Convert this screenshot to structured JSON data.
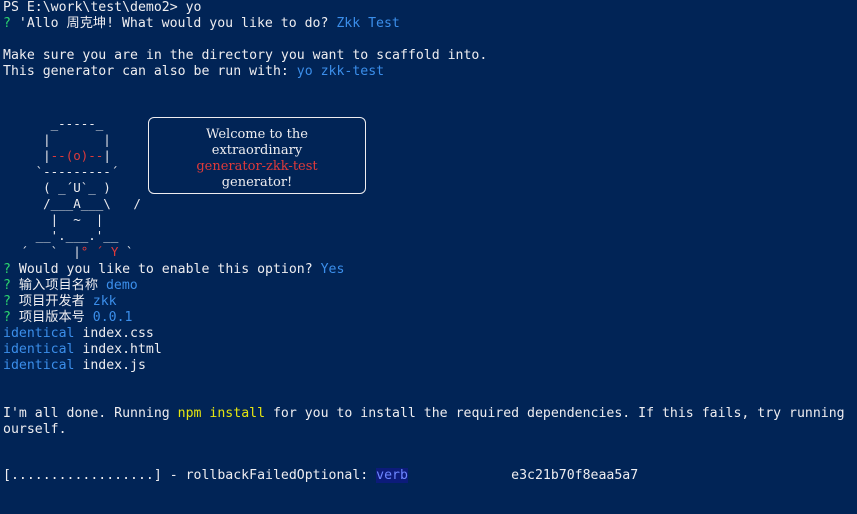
{
  "terminal": {
    "prompt_line": "PS E:\\work\\test\\demo2> yo",
    "greeting_prefix": "? ",
    "greeting_text": "'Allo 周克坤! What would you like to do? ",
    "greeting_answer": "Zkk Test",
    "scaffold_line": "Make sure you are in the directory you want to scaffold into.",
    "run_with_prefix": "This generator can also be run with: ",
    "run_with_cmd": "yo zkk-test"
  },
  "ascii": {
    "l1": "     _-----_",
    "l2": "    |       |",
    "l3_a": "    |",
    "l3_b": "--(o)--",
    "l3_c": "|",
    "l4": "   `---------´",
    "l5": "    ( _´U`_ )",
    "l6": "    /___A___\\   /",
    "l7": "     |  ~  |",
    "l8_a": "   __'.___.'__",
    "l9_a": " ´   `  |",
    "l9_b": "° ´ Y",
    "l9_c": " `",
    "bubble_1": "Welcome to the",
    "bubble_2": "extraordinary",
    "bubble_3": "generator-zkk-test",
    "bubble_4": "generator!"
  },
  "questions": [
    {
      "mark": "? ",
      "q": "Would you like to enable this option? ",
      "a": "Yes"
    },
    {
      "mark": "? ",
      "q": "输入项目名称 ",
      "a": "demo"
    },
    {
      "mark": "? ",
      "q": "项目开发者 ",
      "a": "zkk"
    },
    {
      "mark": "? ",
      "q": "项目版本号 ",
      "a": "0.0.1"
    }
  ],
  "files": [
    {
      "status": "identical",
      "name": " index.css"
    },
    {
      "status": "identical",
      "name": " index.html"
    },
    {
      "status": "identical",
      "name": " index.js"
    }
  ],
  "done": {
    "part1": "I'm all done. Running ",
    "cmd": "npm install",
    "part2": " for you to install the required dependencies. If this fails, try running",
    "line2": "ourself."
  },
  "progress": {
    "bar": "[..................] - rollbackFailedOptional: ",
    "verb": "verb",
    "hash": "             e3c21b70f8eaa5a7"
  }
}
